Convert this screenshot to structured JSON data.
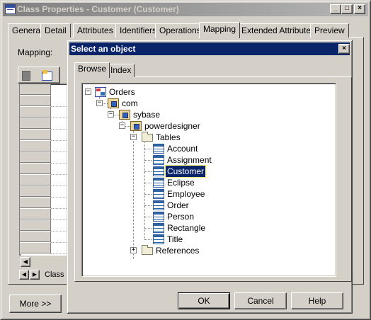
{
  "outer_window": {
    "title": "Class Properties - Customer (Customer)",
    "tabs": [
      "General",
      "Detail",
      "Attributes",
      "Identifiers",
      "Operations",
      "Mapping",
      "Extended Attributes",
      "Preview"
    ],
    "active_tab": "Mapping",
    "mapping_label": "Mapping:",
    "sheet_tab_label": "Class",
    "more_button": "More >>",
    "caption_buttons": {
      "minimize": "_",
      "maximize": "□",
      "close": "×"
    }
  },
  "dialog": {
    "title": "Select an object",
    "close_glyph": "×",
    "tabs": [
      "Browse",
      "Index"
    ],
    "active_tab": "Browse",
    "tree": {
      "root": "Orders",
      "pkg1": "com",
      "pkg2": "sybase",
      "pkg3": "powerdesigner",
      "tables_folder": "Tables",
      "tables": [
        "Account",
        "Assignment",
        "Customer",
        "Eclipse",
        "Employee",
        "Order",
        "Person",
        "Rectangle",
        "Title"
      ],
      "selected": "Customer",
      "references_folder": "References",
      "expanded_glyph": "−",
      "collapsed_glyph": "+"
    },
    "buttons": {
      "ok": "OK",
      "cancel": "Cancel",
      "help": "Help"
    }
  },
  "icons": {
    "app": "class-icon",
    "model": "model-icon",
    "package": "package-icon",
    "folder": "folder-icon",
    "table": "table-icon"
  },
  "colors": {
    "face": "#d4d0c8",
    "active_title": "#0a246a",
    "inactive_title": "#808080",
    "selection": "#0a246a"
  }
}
